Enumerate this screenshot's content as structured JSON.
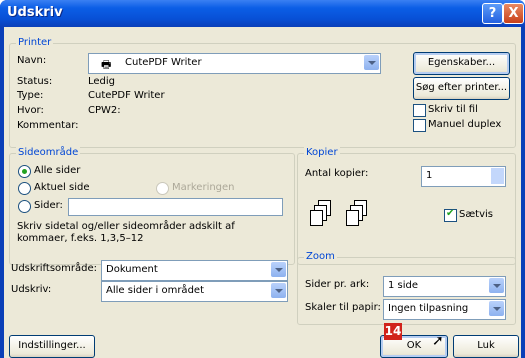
{
  "window": {
    "title": "Udskriv",
    "help_label": "?",
    "close_label": "X"
  },
  "printer": {
    "group_label": "Printer",
    "name_label": "Navn:",
    "name_value": "CutePDF Writer",
    "status_label": "Status:",
    "status_value": "Ledig",
    "type_label": "Type:",
    "type_value": "CutePDF Writer",
    "where_label": "Hvor:",
    "where_value": "CPW2:",
    "comment_label": "Kommentar:",
    "properties_button": "Egenskaber...",
    "find_button": "Søg efter printer...",
    "print_to_file": "Skriv til fil",
    "manual_duplex": "Manuel duplex",
    "print_to_file_checked": false,
    "manual_duplex_checked": false
  },
  "page_range": {
    "group_label": "Sideområde",
    "all_pages": "Alle sider",
    "current_page": "Aktuel side",
    "selection": "Markeringen",
    "pages": "Sider:",
    "pages_value": "",
    "hint": "Skriv sidetal og/eller sideområder adskilt af kommaer, f.eks. 1,3,5–12",
    "selected": "all_pages"
  },
  "copies": {
    "group_label": "Kopier",
    "count_label": "Antal kopier:",
    "count_value": "1",
    "collate_label": "Sætvis",
    "collate_checked": true
  },
  "print_what": {
    "label": "Udskriftsområde:",
    "value": "Dokument"
  },
  "print": {
    "label": "Udskriv:",
    "value": "Alle sider i området"
  },
  "zoom": {
    "group_label": "Zoom",
    "pages_per_sheet_label": "Sider pr. ark:",
    "pages_per_sheet_value": "1 side",
    "scale_label": "Skaler til papir:",
    "scale_value": "Ingen tilpasning"
  },
  "buttons": {
    "options": "Indstillinger...",
    "ok": "OK",
    "cancel": "Luk"
  },
  "annotation": {
    "badge": "14"
  }
}
